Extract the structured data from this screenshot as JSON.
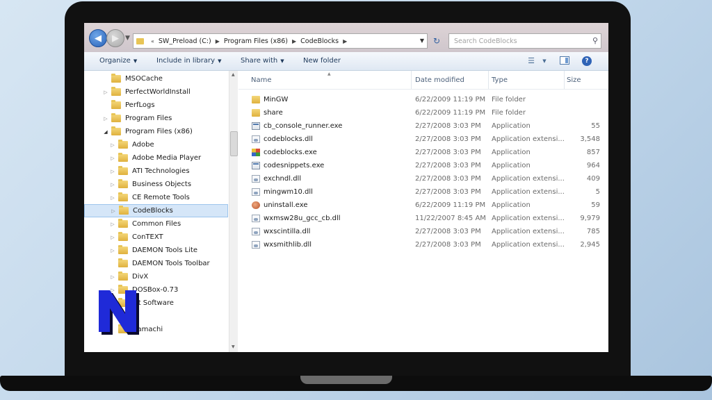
{
  "window": {
    "breadcrumb": [
      "SW_Preload (C:)",
      "Program Files (x86)",
      "CodeBlocks"
    ],
    "search_placeholder": "Search CodeBlocks"
  },
  "toolbar": {
    "organize": "Organize",
    "include_in_library": "Include in library",
    "share_with": "Share with",
    "new_folder": "New folder"
  },
  "nav_tree": [
    {
      "label": "MSOCache",
      "level": 0,
      "expand": "none"
    },
    {
      "label": "PerfectWorldInstall",
      "level": 0,
      "expand": "closed"
    },
    {
      "label": "PerfLogs",
      "level": 0,
      "expand": "none"
    },
    {
      "label": "Program Files",
      "level": 0,
      "expand": "closed"
    },
    {
      "label": "Program Files (x86)",
      "level": 0,
      "expand": "open"
    },
    {
      "label": "Adobe",
      "level": 1,
      "expand": "closed"
    },
    {
      "label": "Adobe Media Player",
      "level": 1,
      "expand": "closed"
    },
    {
      "label": "ATI Technologies",
      "level": 1,
      "expand": "closed"
    },
    {
      "label": "Business Objects",
      "level": 1,
      "expand": "closed"
    },
    {
      "label": "CE Remote Tools",
      "level": 1,
      "expand": "closed"
    },
    {
      "label": "CodeBlocks",
      "level": 1,
      "expand": "closed",
      "selected": true
    },
    {
      "label": "Common Files",
      "level": 1,
      "expand": "closed"
    },
    {
      "label": "ConTEXT",
      "level": 1,
      "expand": "closed"
    },
    {
      "label": "DAEMON Tools Lite",
      "level": 1,
      "expand": "closed"
    },
    {
      "label": "DAEMON Tools Toolbar",
      "level": 1,
      "expand": "none"
    },
    {
      "label": "DivX",
      "level": 1,
      "expand": "closed"
    },
    {
      "label": "DOSBox-0.73",
      "level": 1,
      "expand": "closed"
    },
    {
      "label": "xit Software",
      "level": 1,
      "expand": "closed"
    },
    {
      "label": "",
      "level": 1,
      "expand": "none"
    },
    {
      "label": "Hamachi",
      "level": 1,
      "expand": "none"
    }
  ],
  "columns": {
    "name": "Name",
    "date_modified": "Date modified",
    "type": "Type",
    "size": "Size"
  },
  "files": [
    {
      "name": "MinGW",
      "date": "6/22/2009 11:19 PM",
      "type": "File folder",
      "size": "",
      "icon": "folder-icon"
    },
    {
      "name": "share",
      "date": "6/22/2009 11:19 PM",
      "type": "File folder",
      "size": "",
      "icon": "folder-icon"
    },
    {
      "name": "cb_console_runner.exe",
      "date": "2/27/2008 3:03 PM",
      "type": "Application",
      "size": "55",
      "icon": "exe-icon"
    },
    {
      "name": "codeblocks.dll",
      "date": "2/27/2008 3:03 PM",
      "type": "Application extensi...",
      "size": "3,548",
      "icon": "dll-icon"
    },
    {
      "name": "codeblocks.exe",
      "date": "2/27/2008 3:03 PM",
      "type": "Application",
      "size": "857",
      "icon": "codeblocks-icon"
    },
    {
      "name": "codesnippets.exe",
      "date": "2/27/2008 3:03 PM",
      "type": "Application",
      "size": "964",
      "icon": "exe-icon"
    },
    {
      "name": "exchndl.dll",
      "date": "2/27/2008 3:03 PM",
      "type": "Application extensi...",
      "size": "409",
      "icon": "dll-icon"
    },
    {
      "name": "mingwm10.dll",
      "date": "2/27/2008 3:03 PM",
      "type": "Application extensi...",
      "size": "5",
      "icon": "dll-icon"
    },
    {
      "name": "uninstall.exe",
      "date": "6/22/2009 11:19 PM",
      "type": "Application",
      "size": "59",
      "icon": "uninstall-icon"
    },
    {
      "name": "wxmsw28u_gcc_cb.dll",
      "date": "11/22/2007 8:45 AM",
      "type": "Application extensi...",
      "size": "9,979",
      "icon": "dll-icon"
    },
    {
      "name": "wxscintilla.dll",
      "date": "2/27/2008 3:03 PM",
      "type": "Application extensi...",
      "size": "785",
      "icon": "dll-icon"
    },
    {
      "name": "wxsmithlib.dll",
      "date": "2/27/2008 3:03 PM",
      "type": "Application extensi...",
      "size": "2,945",
      "icon": "dll-icon"
    }
  ],
  "logo": {
    "letter": "N",
    "fill": "#1f2ad8",
    "shadow": "#0a0a2e"
  },
  "colors": {
    "selection": "#d5e6f8",
    "toolbar_text": "#1e395b"
  }
}
